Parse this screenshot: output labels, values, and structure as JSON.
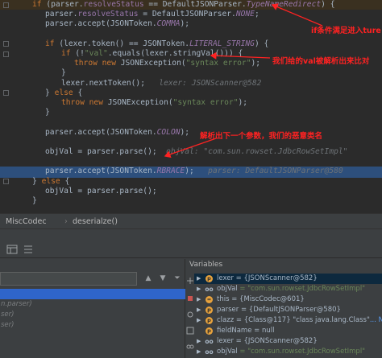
{
  "editor": {
    "lines": [
      {
        "segments": [
          {
            "t": "if",
            "c": "kw"
          },
          {
            "t": " (parser."
          },
          {
            "t": "resolveStatus",
            "c": "fld"
          },
          {
            "t": " == DefaultJSONParser."
          },
          {
            "t": "TypeNameRedirect",
            "c": "cst"
          },
          {
            "t": ") {"
          }
        ],
        "indent": 1
      },
      {
        "segments": [
          {
            "t": "parser."
          },
          {
            "t": "resolveStatus",
            "c": "fld"
          },
          {
            "t": " = DefaultJSONParser."
          },
          {
            "t": "NONE",
            "c": "cst"
          },
          {
            "t": ";"
          }
        ],
        "indent": 2
      },
      {
        "segments": [
          {
            "t": "parser.accept(JSONToken."
          },
          {
            "t": "COMMA",
            "c": "cst"
          },
          {
            "t": ");"
          }
        ],
        "indent": 2
      },
      {
        "segments": [],
        "indent": 0
      },
      {
        "segments": [
          {
            "t": "if",
            "c": "kw"
          },
          {
            "t": " (lexer.token() == JSONToken."
          },
          {
            "t": "LITERAL_STRING",
            "c": "cst"
          },
          {
            "t": ") {"
          }
        ],
        "indent": 2
      },
      {
        "segments": [
          {
            "t": "if",
            "c": "kw"
          },
          {
            "t": " (!"
          },
          {
            "t": "\"val\"",
            "c": "str"
          },
          {
            "t": ".equals(lexer.stringVal())) {"
          }
        ],
        "indent": 3
      },
      {
        "segments": [
          {
            "t": "throw new",
            "c": "kw"
          },
          {
            "t": " JSONException("
          },
          {
            "t": "\"syntax error\"",
            "c": "str"
          },
          {
            "t": ");"
          }
        ],
        "indent": 4
      },
      {
        "segments": [
          {
            "t": "}"
          }
        ],
        "indent": 3
      },
      {
        "segments": [
          {
            "t": "lexer.nextToken();"
          },
          {
            "t": "   lexer: JSONScanner@582",
            "c": "inline-val"
          }
        ],
        "indent": 3
      },
      {
        "segments": [
          {
            "t": "} "
          },
          {
            "t": "else",
            "c": "kw"
          },
          {
            "t": " {"
          }
        ],
        "indent": 2
      },
      {
        "segments": [
          {
            "t": "throw new",
            "c": "kw"
          },
          {
            "t": " JSONException("
          },
          {
            "t": "\"syntax error\"",
            "c": "str"
          },
          {
            "t": ");"
          }
        ],
        "indent": 3
      },
      {
        "segments": [
          {
            "t": "}"
          }
        ],
        "indent": 2
      },
      {
        "segments": [],
        "indent": 0
      },
      {
        "segments": [
          {
            "t": "parser.accept(JSONToken."
          },
          {
            "t": "COLON",
            "c": "cst"
          },
          {
            "t": ");"
          }
        ],
        "indent": 2
      },
      {
        "segments": [],
        "indent": 0
      },
      {
        "segments": [
          {
            "t": "objVal = parser.parse();"
          },
          {
            "t": "  objVal: \"com.sun.rowset.JdbcRowSetImpl\"",
            "c": "inline-val"
          }
        ],
        "indent": 2
      },
      {
        "segments": [],
        "indent": 0
      },
      {
        "segments": [
          {
            "t": "parser.accept(JSONToken."
          },
          {
            "t": "RBRACE",
            "c": "cst"
          },
          {
            "t": ");"
          },
          {
            "t": "   parser: DefaultJSONParser@580",
            "c": "inline-val"
          }
        ],
        "indent": 2
      },
      {
        "segments": [
          {
            "t": "} "
          },
          {
            "t": "else",
            "c": "kw"
          },
          {
            "t": " {"
          }
        ],
        "indent": 1
      },
      {
        "segments": [
          {
            "t": "objVal = parser.parse();"
          }
        ],
        "indent": 2
      },
      {
        "segments": [
          {
            "t": "}"
          }
        ],
        "indent": 1
      }
    ],
    "annotations": {
      "first": "if条件满足进入ture",
      "second": "我们给的val被解析出来比对",
      "third": "解析出下一个参数，我们的恶意类名"
    }
  },
  "breadcrumb": {
    "class": "MiscCodec",
    "method": "deserialze()"
  },
  "frames": {
    "rows": [
      {
        "label": "",
        "selected": true
      },
      {
        "label": "n.parser)",
        "selected": false
      },
      {
        "label": "ser)",
        "selected": false
      },
      {
        "label": "ser)",
        "selected": false
      }
    ]
  },
  "variables": {
    "title": "Variables",
    "rows": [
      {
        "expand": "▶",
        "icon": "p",
        "glyph": "p",
        "name": "lexer",
        "value": " = {JSONScanner@582}",
        "sel": true
      },
      {
        "expand": "▶",
        "icon": "oo",
        "glyph": "oo",
        "name": "objVal",
        "value": " = \"com.sun.rowset.JdbcRowSetImpl\"",
        "str": true
      },
      {
        "expand": "▶",
        "icon": "p",
        "glyph": "=",
        "name": "this",
        "value": " = {MiscCodec@601}"
      },
      {
        "expand": "▶",
        "icon": "p",
        "glyph": "p",
        "name": "parser",
        "value": " = {DefaultJSONParser@580}"
      },
      {
        "expand": "▶",
        "icon": "p",
        "glyph": "p",
        "name": "clazz",
        "value": " = {Class@117} \"class java.lang.Class\"",
        "link": "... Navigate"
      },
      {
        "expand": "",
        "icon": "p",
        "glyph": "p",
        "name": "fieldName",
        "value": " = null"
      },
      {
        "expand": "▶",
        "icon": "oo",
        "glyph": "oo",
        "name": "lexer",
        "value": " = {JSONScanner@582}"
      },
      {
        "expand": "▶",
        "icon": "oo",
        "glyph": "oo",
        "name": "objVal",
        "value": " = \"com.sun.rowset.JdbcRowSetImpl\"",
        "str": true
      }
    ]
  }
}
